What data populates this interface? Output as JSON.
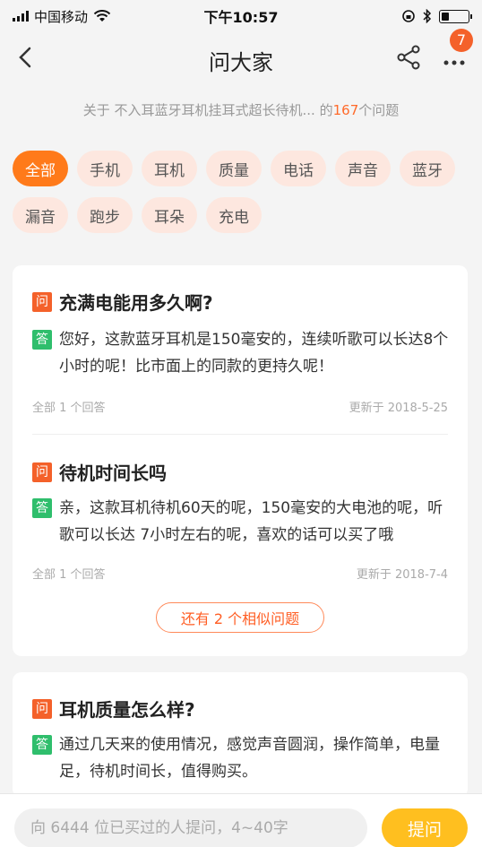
{
  "status_bar": {
    "carrier": "中国移动",
    "time": "下午10:57",
    "battery_level": 0.3
  },
  "nav": {
    "title": "问大家",
    "badge": "7",
    "icons": [
      "back-icon",
      "share-icon",
      "more-icon"
    ]
  },
  "subtitle": {
    "prefix": "关于",
    "product": "不入耳蓝牙耳机挂耳式超长待机...",
    "mid": "的",
    "count": "167",
    "suffix": "个问题"
  },
  "tags": [
    "全部",
    "手机",
    "耳机",
    "质量",
    "电话",
    "声音",
    "蓝牙",
    "漏音",
    "跑步",
    "耳朵",
    "充电"
  ],
  "active_tag": "全部",
  "labels": {
    "q": "问",
    "a": "答"
  },
  "questions": [
    {
      "question": "充满电能用多久啊?",
      "answer": "您好，这款蓝牙耳机是150毫安的，连续听歌可以长达8个小时的呢！比市面上的同款的更持久呢！",
      "answer_count": "全部 1 个回答",
      "updated": "更新于 2018-5-25"
    },
    {
      "question": "待机时间长吗",
      "answer": "亲，这款耳机待机60天的呢，150毫安的大电池的呢，听歌可以长达 7小时左右的呢，喜欢的话可以买了哦",
      "answer_count": "全部 1 个回答",
      "updated": "更新于 2018-7-4"
    },
    {
      "question": "耳机质量怎么样?",
      "answer": "通过几天来的使用情况，感觉声音圆润，操作简单，电量足，待机时间长，值得购买。"
    }
  ],
  "similar_button": "还有 2 个相似问题",
  "bottom": {
    "placeholder": "向 6444 位已买过的人提问，4~40字",
    "ask_label": "提问"
  },
  "colors": {
    "accent": "#ff7a1a",
    "question_icon": "#f4612a",
    "answer_icon": "#2fbe6c",
    "ask_button": "#ffbf1f"
  }
}
